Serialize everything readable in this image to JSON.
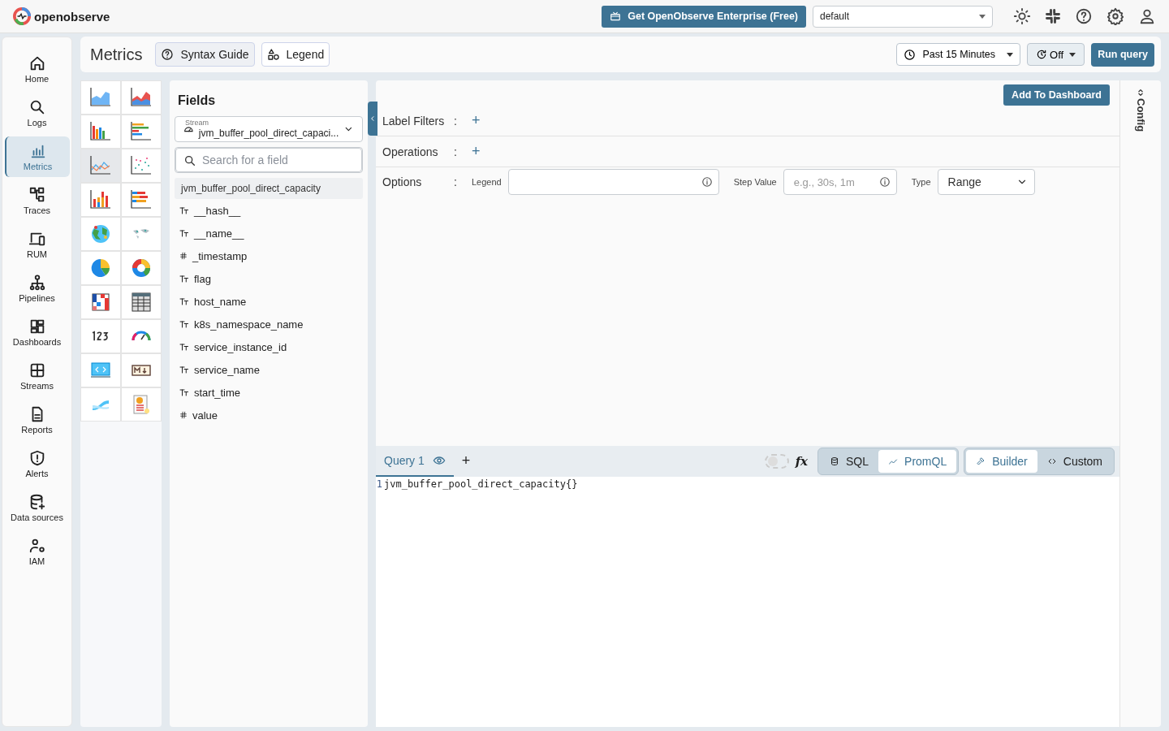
{
  "topbar": {
    "brand": "openobserve",
    "enterprise_button": "Get OpenObserve Enterprise (Free)",
    "organization": "default"
  },
  "nav": [
    {
      "label": "Home",
      "selected": false
    },
    {
      "label": "Logs",
      "selected": false
    },
    {
      "label": "Metrics",
      "selected": true
    },
    {
      "label": "Traces",
      "selected": false
    },
    {
      "label": "RUM",
      "selected": false
    },
    {
      "label": "Pipelines",
      "selected": false
    },
    {
      "label": "Dashboards",
      "selected": false
    },
    {
      "label": "Streams",
      "selected": false
    },
    {
      "label": "Reports",
      "selected": false
    },
    {
      "label": "Alerts",
      "selected": false
    },
    {
      "label": "Data sources",
      "selected": false
    },
    {
      "label": "IAM",
      "selected": false
    }
  ],
  "header": {
    "title": "Metrics",
    "syntax_button": "Syntax Guide",
    "legend_button": "Legend",
    "time_range": "Past 15 Minutes",
    "refresh": "Off",
    "run_button": "Run query"
  },
  "chart_types": [
    {
      "kind": "area",
      "selected": false
    },
    {
      "kind": "area-stacked",
      "selected": false
    },
    {
      "kind": "bar",
      "selected": false
    },
    {
      "kind": "h-bar",
      "selected": false
    },
    {
      "kind": "line",
      "selected": true
    },
    {
      "kind": "scatter",
      "selected": false
    },
    {
      "kind": "stacked",
      "selected": false
    },
    {
      "kind": "h-stacked",
      "selected": false
    },
    {
      "kind": "geomap",
      "selected": false
    },
    {
      "kind": "maps",
      "selected": false
    },
    {
      "kind": "pie",
      "selected": false
    },
    {
      "kind": "donut",
      "selected": false
    },
    {
      "kind": "heatmap",
      "selected": false
    },
    {
      "kind": "table",
      "selected": false
    },
    {
      "kind": "metric",
      "selected": false
    },
    {
      "kind": "gauge",
      "selected": false
    },
    {
      "kind": "html",
      "selected": false
    },
    {
      "kind": "markdown",
      "selected": false
    },
    {
      "kind": "sankey",
      "selected": false
    },
    {
      "kind": "custom",
      "selected": false
    }
  ],
  "fields": {
    "title": "Fields",
    "stream_label": "Stream",
    "stream": "jvm_buffer_pool_direct_capaci...",
    "search_placeholder": "Search for a field",
    "stream_name": "jvm_buffer_pool_direct_capacity",
    "items": [
      {
        "name": "__hash__",
        "kind": "text"
      },
      {
        "name": "__name__",
        "kind": "text"
      },
      {
        "name": "_timestamp",
        "kind": "number"
      },
      {
        "name": "flag",
        "kind": "text"
      },
      {
        "name": "host_name",
        "kind": "text"
      },
      {
        "name": "k8s_namespace_name",
        "kind": "text"
      },
      {
        "name": "service_instance_id",
        "kind": "text"
      },
      {
        "name": "service_name",
        "kind": "text"
      },
      {
        "name": "start_time",
        "kind": "text"
      },
      {
        "name": "value",
        "kind": "number"
      }
    ]
  },
  "builder": {
    "add_button": "Add To Dashboard",
    "label_filters": "Label Filters",
    "operations": "Operations",
    "options": "Options",
    "separator": ":",
    "legend_label": "Legend",
    "step_label": "Step Value",
    "step_placeholder": "e.g., 30s, 1m",
    "type_label": "Type",
    "type_value": "Range",
    "config": "Config"
  },
  "query": {
    "tabs": [
      {
        "label": "Query 1",
        "selected": true
      }
    ],
    "add": "+",
    "toggle_on": false,
    "fx": "fx",
    "languages": [
      {
        "label": "SQL",
        "selected": false
      },
      {
        "label": "PromQL",
        "selected": true
      }
    ],
    "modes": [
      {
        "label": "Builder",
        "selected": true
      },
      {
        "label": "Custom",
        "selected": false
      }
    ],
    "lines": [
      {
        "number": "1",
        "code": "jvm_buffer_pool_direct_capacity{}"
      }
    ]
  }
}
